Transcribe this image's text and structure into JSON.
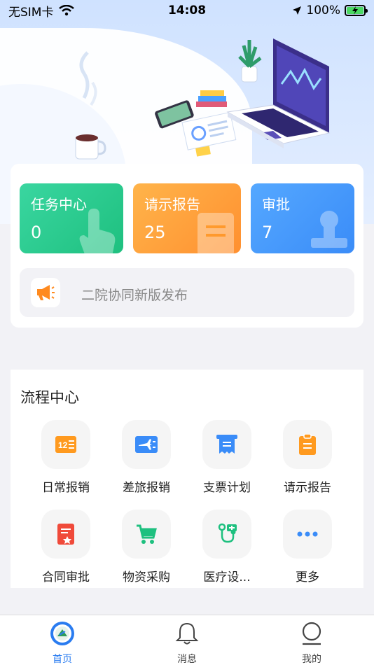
{
  "status": {
    "carrier": "无SIM卡",
    "time": "14:08",
    "battery": "100%"
  },
  "stats": [
    {
      "title": "任务中心",
      "value": "0"
    },
    {
      "title": "请示报告",
      "value": "25"
    },
    {
      "title": "审批",
      "value": "7"
    }
  ],
  "notice": {
    "text": "二院协同新版发布"
  },
  "process": {
    "title": "流程中心",
    "items": [
      {
        "label": "日常报销",
        "icon": "calendar-icon",
        "color": "#ff9a1f"
      },
      {
        "label": "差旅报销",
        "icon": "plane-icon",
        "color": "#3a8cf8"
      },
      {
        "label": "支票计划",
        "icon": "receipt-icon",
        "color": "#3a8cf8"
      },
      {
        "label": "请示报告",
        "icon": "clipboard-icon",
        "color": "#ff9a1f"
      },
      {
        "label": "合同审批",
        "icon": "contract-icon",
        "color": "#f04a3a"
      },
      {
        "label": "物资采购",
        "icon": "cart-icon",
        "color": "#1ec07f"
      },
      {
        "label": "医疗设...",
        "icon": "stethoscope-icon",
        "color": "#1ec07f"
      },
      {
        "label": "更多",
        "icon": "more-icon",
        "color": "#3a8cf8"
      }
    ]
  },
  "tabs": [
    {
      "label": "首页",
      "icon": "home-logo-icon",
      "active": true
    },
    {
      "label": "消息",
      "icon": "bell-icon",
      "active": false
    },
    {
      "label": "我的",
      "icon": "user-icon",
      "active": false
    }
  ],
  "colors": {
    "accent": "#2a7cf0",
    "green": "#1ec07f",
    "orange": "#ff9a1f",
    "blue": "#3a8cf8"
  }
}
